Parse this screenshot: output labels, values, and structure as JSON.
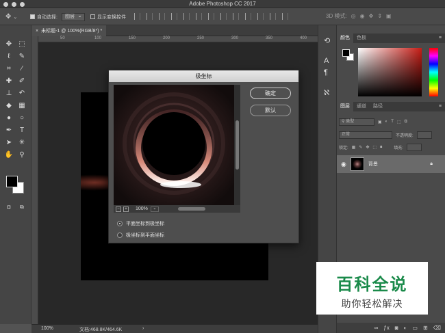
{
  "window": {
    "title": "Adobe Photoshop CC 2017"
  },
  "options_bar": {
    "auto_select_label": "自动选择:",
    "auto_select_value": "图层",
    "show_transform_label": "显示变换控件",
    "mode_3d_label": "3D 模式:"
  },
  "document_tab": {
    "title": "未标题-1 @ 100%(RGB/8*) *",
    "close": "×"
  },
  "ruler": {
    "ticks": [
      "50",
      "100",
      "150",
      "200",
      "250",
      "300",
      "350",
      "400"
    ]
  },
  "status_bar": {
    "zoom": "100%",
    "doc_info": "文档:468.8K/464.6K",
    "arrow": "›"
  },
  "dialog": {
    "title": "极坐标",
    "ok_label": "确定",
    "default_label": "默认",
    "zoom_minus": "−",
    "zoom_plus": "+",
    "preview_zoom": "100%",
    "zoom_menu": "⌄",
    "options": [
      {
        "label": "平面坐标到极坐标",
        "selected": true
      },
      {
        "label": "极坐标到平面坐标",
        "selected": false
      }
    ]
  },
  "tools": [
    {
      "name": "move-tool-icon",
      "glyph": "✥"
    },
    {
      "name": "marquee-tool-icon",
      "glyph": "⬚"
    },
    {
      "name": "lasso-tool-icon",
      "glyph": "ℓ"
    },
    {
      "name": "quick-select-tool-icon",
      "glyph": "✎"
    },
    {
      "name": "crop-tool-icon",
      "glyph": "⌗"
    },
    {
      "name": "eyedropper-tool-icon",
      "glyph": "⁄"
    },
    {
      "name": "healing-tool-icon",
      "glyph": "✚"
    },
    {
      "name": "brush-tool-icon",
      "glyph": "✐"
    },
    {
      "name": "stamp-tool-icon",
      "glyph": "⊥"
    },
    {
      "name": "history-brush-tool-icon",
      "glyph": "↶"
    },
    {
      "name": "eraser-tool-icon",
      "glyph": "◆"
    },
    {
      "name": "gradient-tool-icon",
      "glyph": "▦"
    },
    {
      "name": "blur-tool-icon",
      "glyph": "●"
    },
    {
      "name": "dodge-tool-icon",
      "glyph": "○"
    },
    {
      "name": "pen-tool-icon",
      "glyph": "✒"
    },
    {
      "name": "type-tool-icon",
      "glyph": "T"
    },
    {
      "name": "path-select-tool-icon",
      "glyph": "➤"
    },
    {
      "name": "shape-tool-icon",
      "glyph": "✳"
    },
    {
      "name": "hand-tool-icon",
      "glyph": "✋"
    },
    {
      "name": "zoom-tool-icon",
      "glyph": "⚲"
    }
  ],
  "panels": {
    "color_tabs": [
      "颜色",
      "色板"
    ],
    "layer_tabs": [
      "图层",
      "通道",
      "路径"
    ],
    "kind_label": "类型",
    "blend_mode": "正常",
    "opacity_label": "不透明度:",
    "lock_label": "锁定:",
    "fill_label": "填充:",
    "layer_name": "背景",
    "menu_glyph": "≡"
  },
  "watermark": {
    "line1": "百科全说",
    "line2": "助你轻松解决"
  }
}
